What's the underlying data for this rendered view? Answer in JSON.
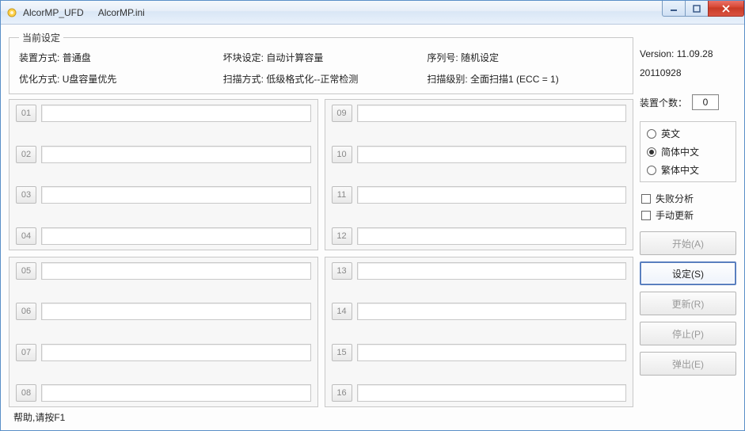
{
  "window": {
    "title1": "AlcorMP_UFD",
    "title2": "AlcorMP.ini"
  },
  "settings": {
    "legend": "当前设定",
    "mount_label": "装置方式:",
    "mount_value": "普通盘",
    "badblock_label": "坏块设定:",
    "badblock_value": "自动计算容量",
    "serial_label": "序列号:",
    "serial_value": "随机设定",
    "opt_label": "优化方式:",
    "opt_value": "U盘容量优先",
    "scan_label": "扫描方式:",
    "scan_value": "低级格式化--正常检测",
    "scanlevel_label": "扫描级别:",
    "scanlevel_value": "全面扫描1 (ECC = 1)"
  },
  "slots": {
    "p1": [
      "01",
      "02",
      "03",
      "04"
    ],
    "p2": [
      "09",
      "10",
      "11",
      "12"
    ],
    "p3": [
      "05",
      "06",
      "07",
      "08"
    ],
    "p4": [
      "13",
      "14",
      "15",
      "16"
    ]
  },
  "side": {
    "version_label": "Version:",
    "version_value": "11.09.28",
    "date": "20110928",
    "count_label": "装置个数：",
    "count_value": "0",
    "lang_en": "英文",
    "lang_sc": "简体中文",
    "lang_tc": "繁体中文",
    "chk_fail": "失败分析",
    "chk_manual": "手动更新",
    "btn_start": "开始(A)",
    "btn_setup": "设定(S)",
    "btn_update": "更新(R)",
    "btn_stop": "停止(P)",
    "btn_eject": "弹出(E)"
  },
  "status": "帮助,请按F1"
}
